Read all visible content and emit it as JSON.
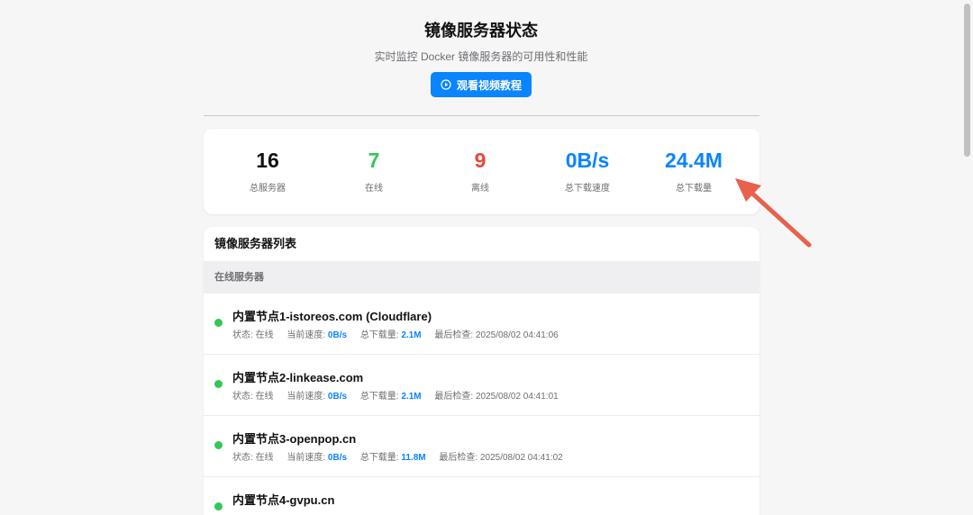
{
  "header": {
    "title": "镜像服务器状态",
    "subtitle": "实时监控 Docker 镜像服务器的可用性和性能",
    "video_button_label": "观看视频教程"
  },
  "stats": [
    {
      "value": "16",
      "label": "总服务器",
      "color": "#111111"
    },
    {
      "value": "7",
      "label": "在线",
      "color": "#34c759"
    },
    {
      "value": "9",
      "label": "离线",
      "color": "#e5483b"
    },
    {
      "value": "0B/s",
      "label": "总下载速度",
      "color": "#0a84ff"
    },
    {
      "value": "24.4M",
      "label": "总下载量",
      "color": "#0a84ff"
    }
  ],
  "server_list": {
    "title": "镜像服务器列表",
    "online_section_label": "在线服务器",
    "servers": [
      {
        "name": "内置节点1-istoreos.com (Cloudflare)",
        "status_label": "状态:",
        "status": "在线",
        "speed_label": "当前速度:",
        "speed": "0B/s",
        "total_label": "总下载量:",
        "total": "2.1M",
        "checked_label": "最后检查:",
        "checked": "2025/08/02 04:41:06"
      },
      {
        "name": "内置节点2-linkease.com",
        "status_label": "状态:",
        "status": "在线",
        "speed_label": "当前速度:",
        "speed": "0B/s",
        "total_label": "总下载量:",
        "total": "2.1M",
        "checked_label": "最后检查:",
        "checked": "2025/08/02 04:41:01"
      },
      {
        "name": "内置节点3-openpop.cn",
        "status_label": "状态:",
        "status": "在线",
        "speed_label": "当前速度:",
        "speed": "0B/s",
        "total_label": "总下载量:",
        "total": "11.8M",
        "checked_label": "最后检查:",
        "checked": "2025/08/02 04:41:02"
      },
      {
        "name": "内置节点4-gvpu.cn",
        "status_label": "",
        "status": "",
        "speed_label": "",
        "speed": "",
        "total_label": "",
        "total": "",
        "checked_label": "",
        "checked": ""
      }
    ]
  },
  "colors": {
    "accent": "#0a84ff",
    "online": "#34c759",
    "offline": "#e5483b",
    "annotation_arrow": "#e8614d"
  }
}
